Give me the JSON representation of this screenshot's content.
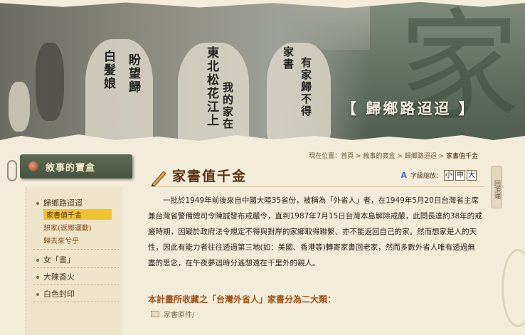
{
  "banner": {
    "title": "【 歸鄉路迢迢 】",
    "big_char": "家",
    "shirt_text": [
      "白髮娘",
      "盼望歸",
      "東北松花江上",
      "我的家在",
      "家書",
      "有家歸不得"
    ]
  },
  "sidebar": {
    "header": "敘事的寶盒",
    "items": [
      {
        "label": "歸鄉路迢迢"
      },
      {
        "label": "女「書」"
      },
      {
        "label": "大陳香火"
      },
      {
        "label": "白色封印"
      }
    ],
    "subitems": [
      {
        "label": "家書值千金",
        "active": true
      },
      {
        "label": "想家(返鄉運動)",
        "active": false
      },
      {
        "label": "歸去來兮乎",
        "active": false
      }
    ]
  },
  "breadcrumb": {
    "prefix": "現在位置：",
    "items": [
      "首頁",
      "敘事的寶盒",
      "歸鄉路迢迢"
    ],
    "current": "家書值千金",
    "separator": " > "
  },
  "page": {
    "title": "家書值千金",
    "font_label": "字級縮放：",
    "font_sizes": [
      "小",
      "中",
      "大"
    ],
    "paragraph": "一批於1949年前後來自中國大陸35省份，被稱為「外省人」者，在1949年5月20日台灣省主席兼台灣省警備總司令陳誠發布戒嚴令，直到1987年7月15日台灣本島解除戒嚴，此間長達約38年的戒嚴時期，因礙於政府法令規定不得與對岸的家鄉取得聯繫、亦不能返回自己的家。然而想家是人的天性，因此有能力者往往透過第三地(如：美國、香港等)轉寄家書回老家，然而多數外省人唯有透過無盡的思念，在午夜夢迴時分遙想遠在千里外的親人。",
    "subheading": "本計畫所收藏之「台灣外省人」家書分為二大類：",
    "doc_link": "家書原件/"
  },
  "rail": {
    "label": "回頂端"
  }
}
